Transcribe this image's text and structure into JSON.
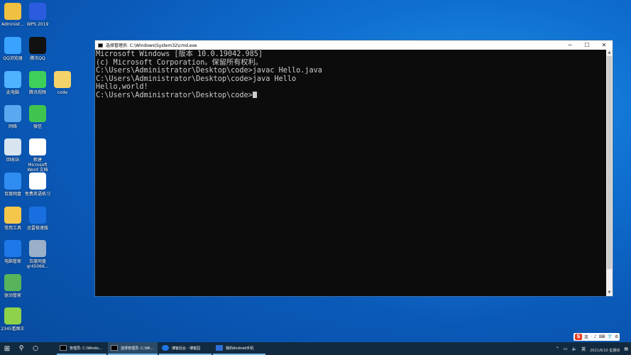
{
  "desktop": {
    "icons": [
      {
        "label": "Administ...",
        "color": "#f0c040"
      },
      {
        "label": "WPS 2019",
        "color": "#2b5ce0"
      },
      {
        "label": "QQ浏览器",
        "color": "#3aa3ff"
      },
      {
        "label": "腾讯QQ",
        "color": "#111111"
      },
      {
        "label": "此电脑",
        "color": "#4fb3ff"
      },
      {
        "label": "腾讯视频",
        "color": "#3ecf5a"
      },
      {
        "label": "code",
        "color": "#f4d36b"
      },
      {
        "label": "网络",
        "color": "#5aa8f0"
      },
      {
        "label": "微信",
        "color": "#3fc54f"
      },
      {
        "label": "回收站",
        "color": "#d8e4ef"
      },
      {
        "label": "新建 Microsoft Word 文档",
        "color": "#ffffff"
      },
      {
        "label": "百度网盘",
        "color": "#2f8cf0"
      },
      {
        "label": "免费英语练习",
        "color": "#ffffff"
      },
      {
        "label": "常用工具",
        "color": "#f4c64a"
      },
      {
        "label": "迅雷极速版",
        "color": "#1a6fe0"
      },
      {
        "label": "电脑管家",
        "color": "#1e78e8"
      },
      {
        "label": "百度网盘\nqr45066...",
        "color": "#9ab0c8"
      },
      {
        "label": "驱动管家",
        "color": "#57b45a"
      },
      {
        "label": "2345看图王",
        "color": "#8ed14a"
      }
    ]
  },
  "cmd": {
    "title": "选择管理员: C:\\Windows\\System32\\cmd.exe",
    "controls": {
      "minimize": "─",
      "maximize": "☐",
      "close": "✕"
    },
    "lines": [
      "Microsoft Windows [版本 10.0.19042.985]",
      "(c) Microsoft Corporation。保留所有权利。",
      "",
      "C:\\Users\\Administrator\\Desktop\\code>javac Hello.java",
      "",
      "C:\\Users\\Administrator\\Desktop\\code>java Hello",
      "Hello,world!",
      "C:\\Users\\Administrator\\Desktop\\code>"
    ],
    "scroll": {
      "up": "▲",
      "down": "▼"
    }
  },
  "taskbar": {
    "start_glyph": "⊞",
    "search_glyph": "⚲",
    "task_view_glyph": "○",
    "apps": [
      {
        "label": "管理员: C:\\Windo...",
        "active": false
      },
      {
        "label": "选择管理员: C:\\Wi...",
        "active": true
      },
      {
        "label": "博客后台 - 博客园",
        "active": false
      },
      {
        "label": "我的Android手机",
        "active": false
      }
    ],
    "tray": {
      "clock_time": "",
      "clock_date": "2021/6/10 星期四"
    }
  },
  "ime": {
    "logo": "S",
    "items": [
      "英",
      "·",
      "♪",
      "⌨",
      "👕",
      "⚙"
    ]
  }
}
